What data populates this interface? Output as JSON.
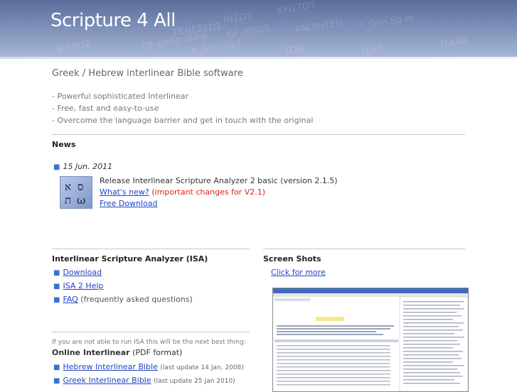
{
  "banner": {
    "title": "Scripture 4 All",
    "background_words": [
      "ΒΙΒΛΟΣ",
      "ΓΕΝΕΣΕΩΣ",
      "ΙΗΣΟΥ",
      "ΧΡΙΣΤΟΥ",
      "OF-JESUS",
      "ANOINTED",
      "OF-generating",
      "n_Gen.Sg.m",
      "n_Gen.Sg.f",
      "ΤΟΝ",
      "ΙΣΑΚ",
      "ΙΣΑΑΚ"
    ]
  },
  "subtitle": "Greek / Hebrew interlinear Bible software",
  "features": [
    "- Powerful sophisticated Interlinear",
    "- Free, fast and easy-to-use",
    "- Overcome the language barrier and get in touch with the original"
  ],
  "news": {
    "heading": "News",
    "date": "15 Jun. 2011",
    "release_text": "Release Interlinear Scripture Analyzer 2 basic (version 2.1.5)",
    "whats_new": "What's new?",
    "important": "(important changes for V2.1)",
    "download": "Free Download",
    "icon_glyphs": "א ת\nת ω"
  },
  "isa": {
    "heading": "Interlinear Scripture Analyzer (ISA)",
    "items": [
      {
        "label": "Download",
        "suffix": ""
      },
      {
        "label": "ISA 2 Help",
        "suffix": ""
      },
      {
        "label": "FAQ",
        "suffix": "(frequently asked questions)"
      }
    ],
    "note": "If you are not able to run ISA this will be the next best thing:",
    "online_label": "Online Interlinear",
    "online_format": "(PDF format)",
    "online_items": [
      {
        "label": "Hebrew Interlinear Bible",
        "suffix": "(last update 14 Jan. 2008)"
      },
      {
        "label": "Greek Interlinear Bible",
        "suffix": "(last update 25 Jan 2010)"
      }
    ]
  },
  "screens": {
    "heading": "Screen Shots",
    "link": "Click for more"
  },
  "colors": {
    "link": "#1f43c9",
    "accent_red": "#e0201e",
    "banner": "#7b8db7"
  }
}
